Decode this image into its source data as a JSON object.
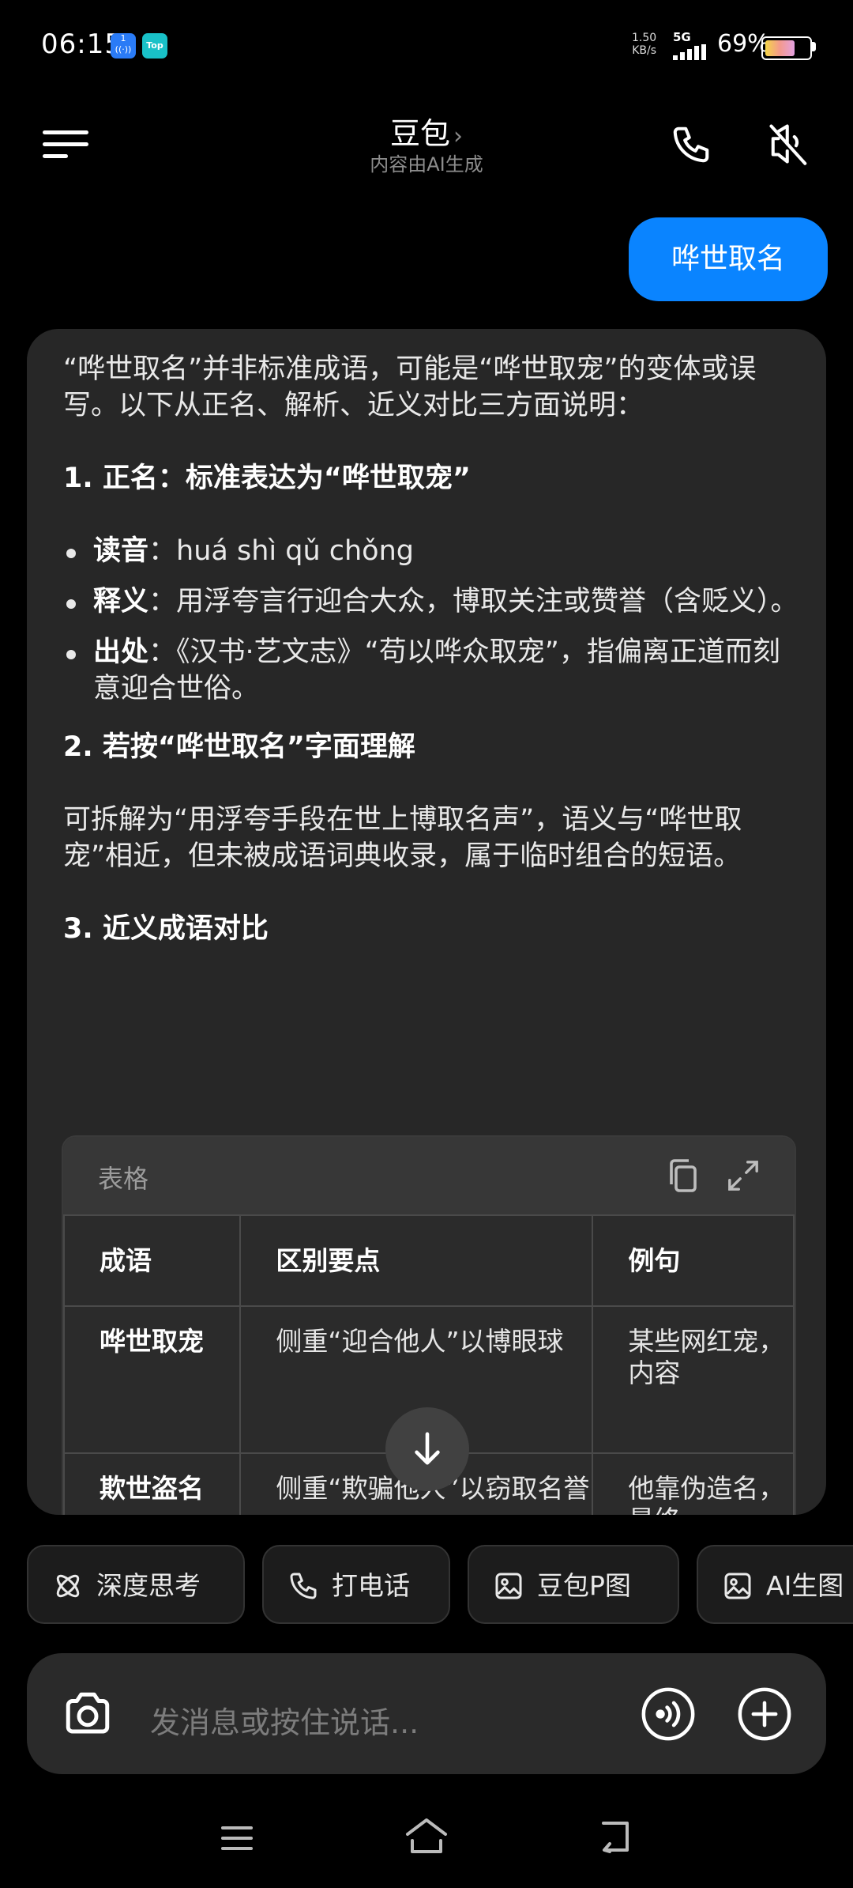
{
  "status_bar": {
    "time": "06:15",
    "notif_a": "1",
    "notif_b": "Top",
    "net_speed_value": "1.50",
    "net_speed_unit": "KB/s",
    "network": "5G",
    "battery": "69%",
    "battery_level": 0.69
  },
  "header": {
    "title": "豆包",
    "title_chevron": "›",
    "subtitle": "内容由AI生成"
  },
  "user_message": "哗世取名",
  "answer": {
    "intro": "“哗世取名”并非标准成语，可能是“哗世取宠”的变体或误写。以下从正名、解析、近义对比三方面说明：",
    "s1_heading": "1. 正名：标准表达为“哗世取宠”",
    "bullets": [
      {
        "term": "读音",
        "text": "：huá shì qǔ chǒng"
      },
      {
        "term": "释义",
        "text": "：用浮夸言行迎合大众，博取关注或赞誉（含贬义）。"
      },
      {
        "term": "出处",
        "text": "：《汉书·艺文志》“苟以哗众取宠”，指偏离正道而刻意迎合世俗。"
      }
    ],
    "s2_heading": "2. 若按“哗世取名”字面理解",
    "s2_text": "可拆解为“用浮夸手段在世上博取名声”，语义与“哗世取宠”相近，但未被成语词典收录，属于临时组合的短语。",
    "s3_heading": "3. 近义成语对比",
    "table": {
      "label": "表格",
      "headers": [
        "成语",
        "区别要点",
        "例句"
      ],
      "rows": [
        [
          "哗世取宠",
          "侧重“迎合他人”以博眼球",
          "某些网红宠，内容"
        ],
        [
          "欺世盗名",
          "侧重“欺骗他人”以窃取名誉",
          "他靠伪造名，最终"
        ]
      ]
    }
  },
  "chips": [
    "深度思考",
    "打电话",
    "豆包P图",
    "AI生图"
  ],
  "input": {
    "placeholder": "发消息或按住说话..."
  }
}
